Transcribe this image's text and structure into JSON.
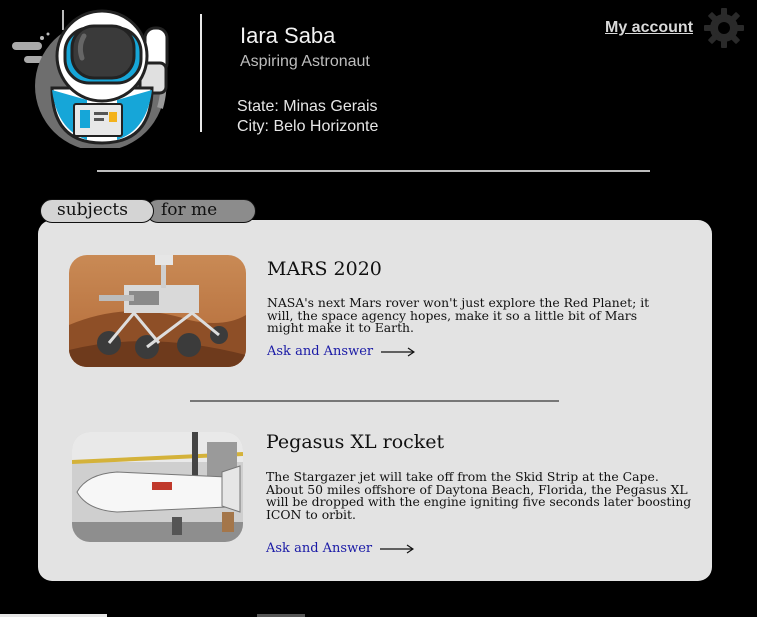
{
  "profile": {
    "name": "Iara Saba",
    "role": "Aspiring Astronaut",
    "state": "State: Minas Gerais",
    "city": "City: Belo Horizonte"
  },
  "header": {
    "account_link": "My account",
    "settings_icon": "gear-icon",
    "avatar_icon": "astronaut-icon"
  },
  "tabs": [
    {
      "label": "subjects",
      "active": true
    },
    {
      "label": "for me",
      "active": false
    }
  ],
  "cards": [
    {
      "title": "MARS 2020",
      "text": "NASA's next Mars rover won't just explore the Red Planet; it will, the space agency hopes, make it so a little bit of Mars might make it to Earth.",
      "link": "Ask and Answer",
      "image": "mars-rover-photo"
    },
    {
      "title": "Pegasus XL rocket",
      "text": "The Stargazer jet will take off from the Skid Strip at the Cape. About 50 miles offshore of Daytona Beach, Florida, the Pegasus XL will be dropped with the engine igniting five seconds later boosting ICON to orbit.",
      "link": "Ask and Answer",
      "image": "rocket-hangar-photo"
    }
  ],
  "colors": {
    "background": "#000000",
    "panel": "#e3e3e3",
    "link": "#1a1aa6",
    "tab_active": "#d4d4d4",
    "tab_inactive": "#8c8c8c"
  }
}
